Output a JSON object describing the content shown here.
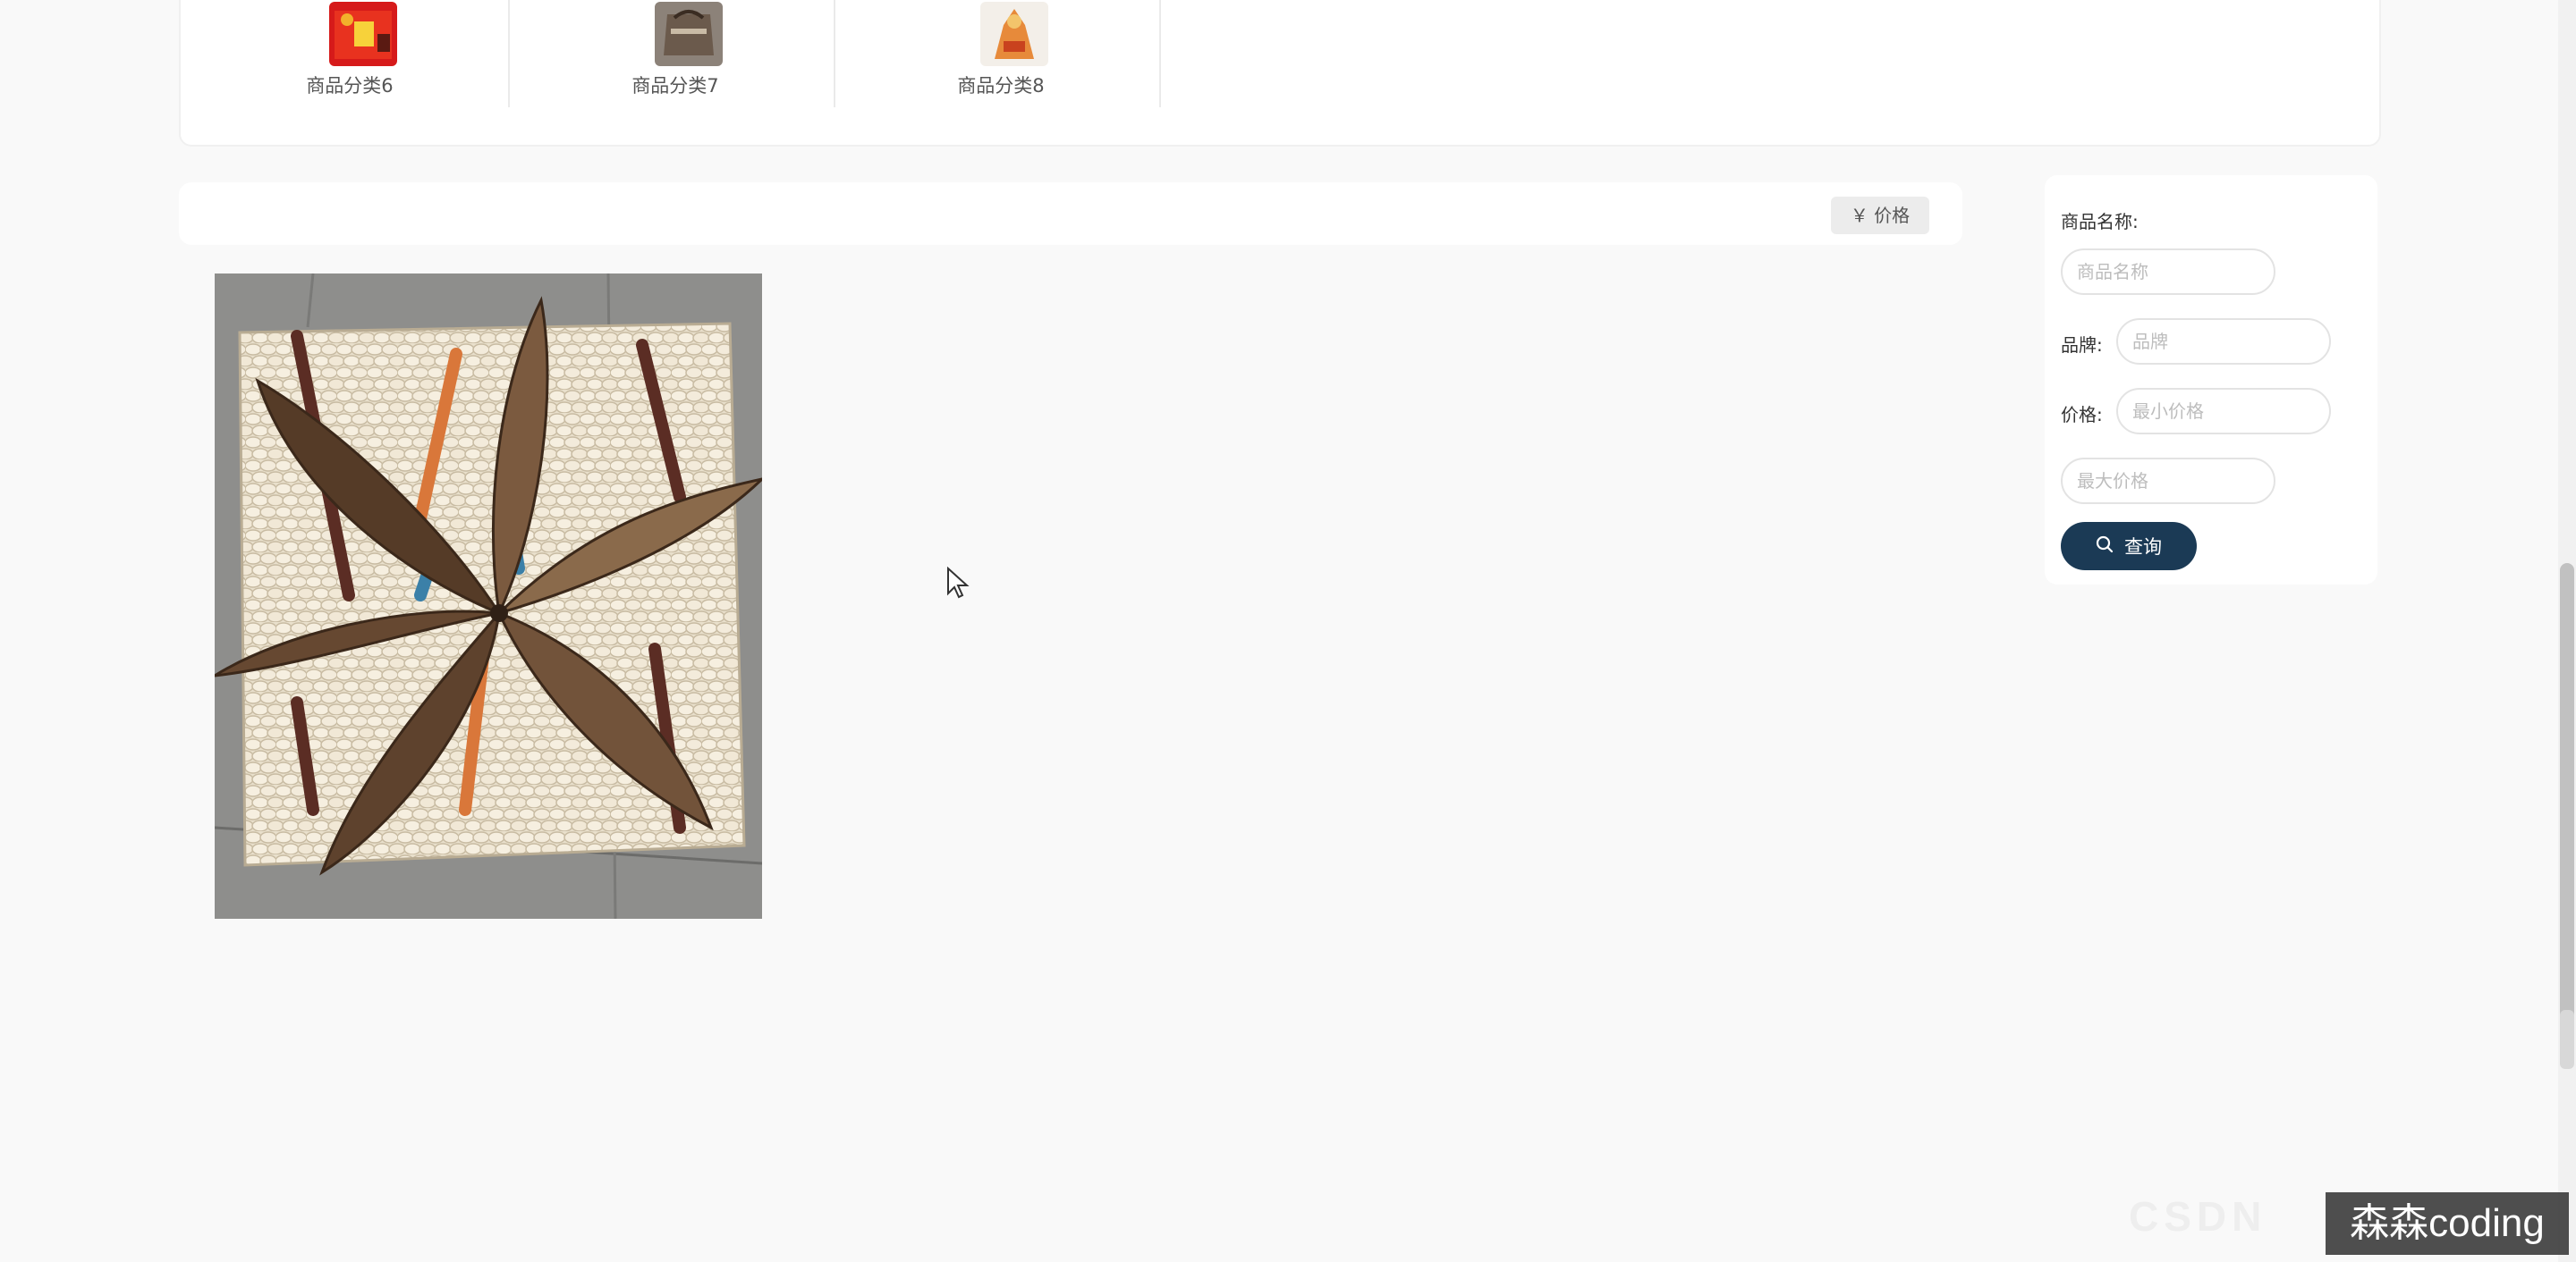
{
  "categories": [
    {
      "label": "商品分类6",
      "icon": "gift-box-icon"
    },
    {
      "label": "商品分类7",
      "icon": "bag-icon"
    },
    {
      "label": "商品分类8",
      "icon": "figurine-icon"
    }
  ],
  "sort_bar": {
    "price_sort_label": "￥ 价格"
  },
  "products": [
    {
      "image": "woven-mat-product-image"
    }
  ],
  "filter": {
    "name_label": "商品名称:",
    "name_placeholder": "商品名称",
    "brand_label": "品牌:",
    "brand_placeholder": "品牌",
    "price_label": "价格:",
    "min_price_placeholder": "最小价格",
    "max_price_placeholder": "最大价格",
    "search_label": "查询"
  },
  "watermark": {
    "text": "森森coding",
    "faint_text": "CSDN"
  },
  "colors": {
    "primary": "#1b3a55",
    "page_background": "#f9f9f9",
    "card_background": "#ffffff"
  }
}
